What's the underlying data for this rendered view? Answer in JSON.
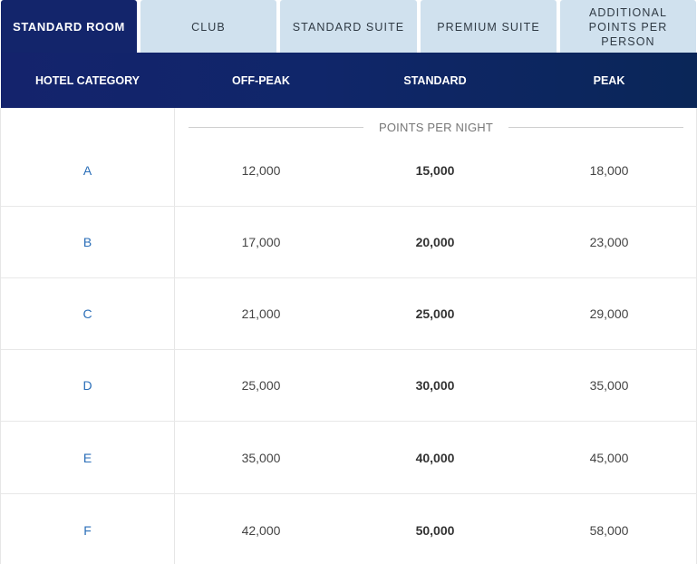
{
  "tabs": [
    {
      "label": "STANDARD ROOM",
      "active": true
    },
    {
      "label": "CLUB",
      "active": false
    },
    {
      "label": "STANDARD SUITE",
      "active": false
    },
    {
      "label": "PREMIUM SUITE",
      "active": false
    },
    {
      "label": "ADDITIONAL POINTS PER PERSON",
      "active": false
    }
  ],
  "columns": [
    "HOTEL CATEGORY",
    "OFF-PEAK",
    "STANDARD",
    "PEAK"
  ],
  "points_per_night_label": "POINTS PER NIGHT",
  "rows": [
    {
      "category": "A",
      "off_peak": "12,000",
      "standard": "15,000",
      "peak": "18,000"
    },
    {
      "category": "B",
      "off_peak": "17,000",
      "standard": "20,000",
      "peak": "23,000"
    },
    {
      "category": "C",
      "off_peak": "21,000",
      "standard": "25,000",
      "peak": "29,000"
    },
    {
      "category": "D",
      "off_peak": "25,000",
      "standard": "30,000",
      "peak": "35,000"
    },
    {
      "category": "E",
      "off_peak": "35,000",
      "standard": "40,000",
      "peak": "45,000"
    },
    {
      "category": "F",
      "off_peak": "42,000",
      "standard": "50,000",
      "peak": "58,000"
    }
  ],
  "colors": {
    "active_tab": "#13256b",
    "inactive_tab": "#d0e1ee",
    "header_start": "#14236c",
    "header_end": "#0a2658",
    "category_link": "#2a6eb8"
  }
}
